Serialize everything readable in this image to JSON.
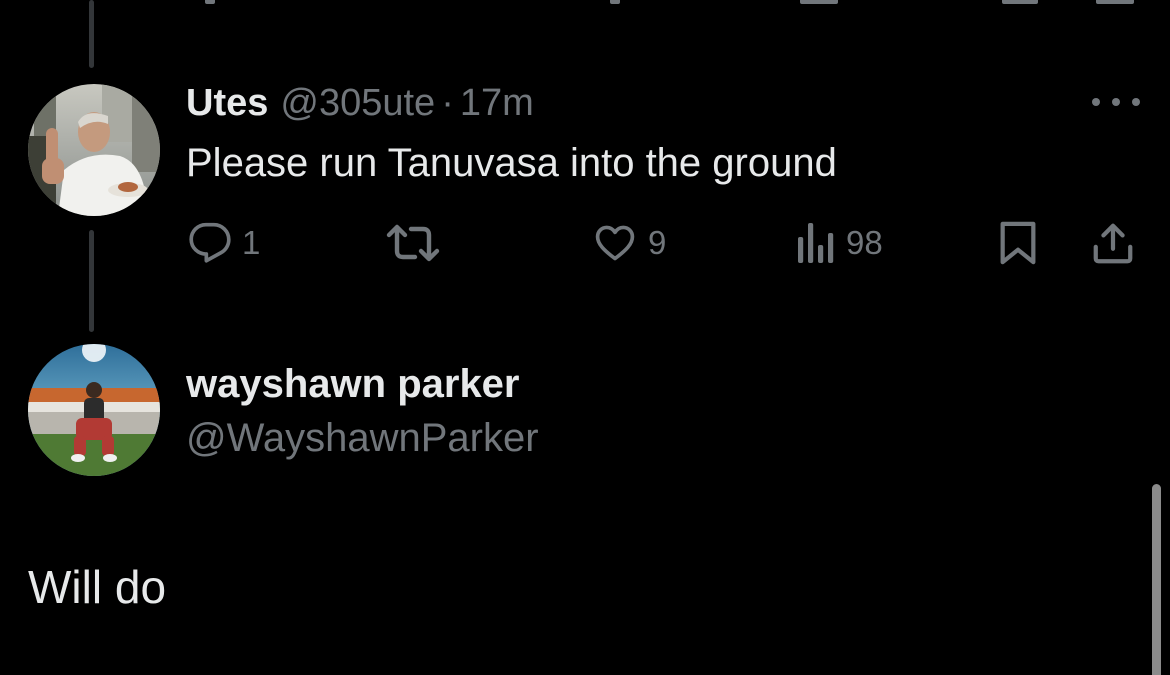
{
  "colors": {
    "background": "#000000",
    "primary_text": "#e7e9ea",
    "secondary_text": "#71767b",
    "thread_line": "#333639"
  },
  "tweet": {
    "display_name": "Utes",
    "handle": "@305ute",
    "separator": "·",
    "time": "17m",
    "text": "Please run Tanuvasa into the ground",
    "more_icon": "more-horizontal-icon",
    "actions": {
      "reply": {
        "icon": "reply-icon",
        "count": "1"
      },
      "retweet": {
        "icon": "retweet-icon",
        "count": ""
      },
      "like": {
        "icon": "heart-icon",
        "count": "9"
      },
      "views": {
        "icon": "views-icon",
        "count": "98"
      },
      "bookmark": {
        "icon": "bookmark-icon"
      },
      "share": {
        "icon": "share-icon"
      }
    }
  },
  "reply": {
    "display_name": "wayshawn parker",
    "handle": "@WayshawnParker",
    "text": "Will do"
  }
}
